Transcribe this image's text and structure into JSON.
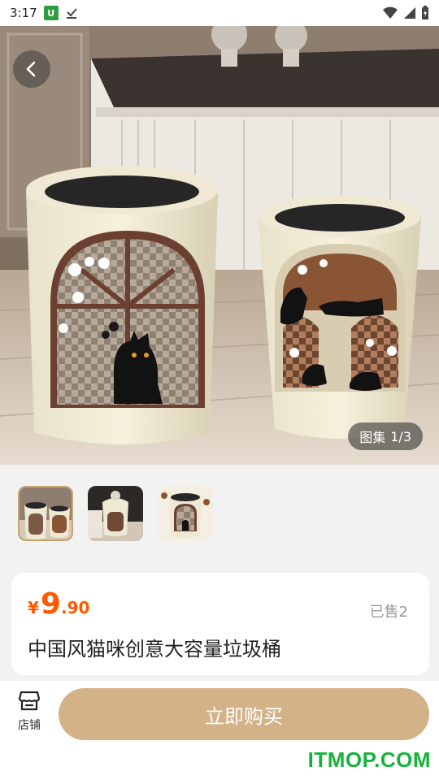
{
  "status_bar": {
    "time": "3:17",
    "app_badge": "U"
  },
  "gallery": {
    "counter_label": "图集",
    "counter_value": "1/3"
  },
  "product": {
    "price_symbol": "¥",
    "price_int": "9",
    "price_dec": ".90",
    "sold": "已售2",
    "title": "中国风猫咪创意大容量垃圾桶"
  },
  "bottom_bar": {
    "shop_label": "店铺",
    "buy_label": "立即购买"
  },
  "watermark": "ITMOP.COM",
  "colors": {
    "price": "#ff5a00",
    "buy_button": "#d3b288",
    "thumb_active_border": "#c8a46f",
    "watermark": "#17b23b"
  }
}
